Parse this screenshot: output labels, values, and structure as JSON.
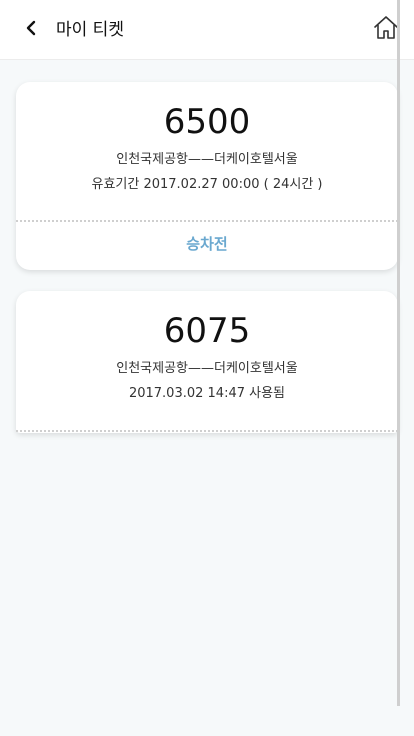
{
  "header": {
    "title": "마이 티켓",
    "back_icon": "chevron-left-icon",
    "home_icon": "home-icon"
  },
  "colors": {
    "background": "#f6f9fa",
    "status_accent": "#6aa8cf"
  },
  "tickets": [
    {
      "number": "6500",
      "route": "인천국제공항——더케이호텔서울",
      "validity": "유효기간 2017.02.27 00:00 ( 24시간 )",
      "status": "승차전"
    },
    {
      "number": "6075",
      "route": "인천국제공항——더케이호텔서울",
      "validity": "2017.03.02 14:47 사용됨"
    }
  ]
}
